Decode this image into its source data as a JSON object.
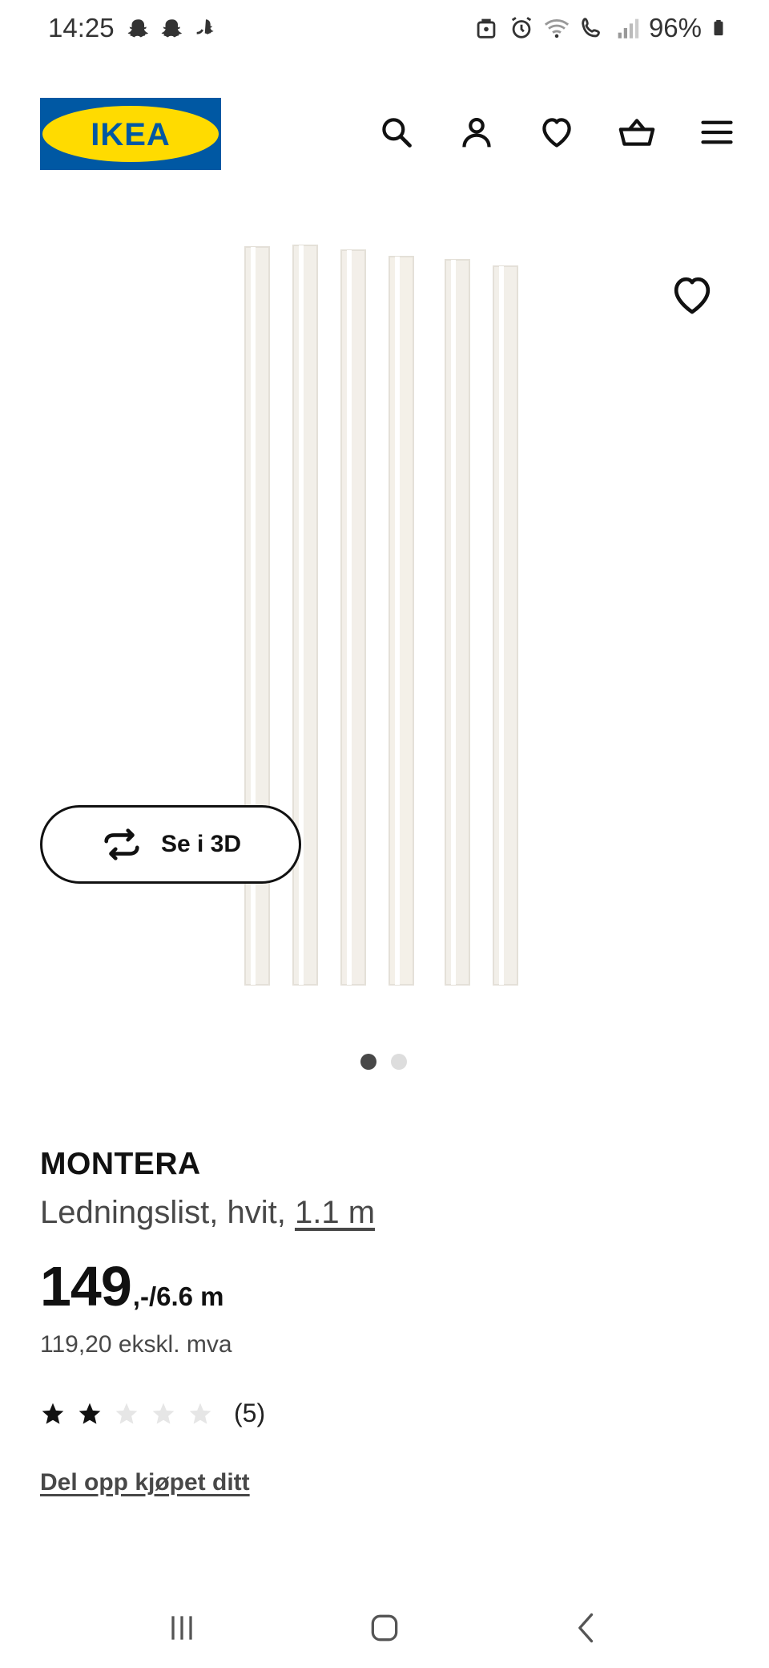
{
  "status": {
    "time": "14:25",
    "battery": "96%",
    "left_icons": [
      "snapchat-icon",
      "snapchat-icon",
      "snapchat-icon"
    ],
    "right_icons": [
      "briefcase-icon",
      "alarm-icon",
      "wifi-icon",
      "wifi-call-icon",
      "signal-icon",
      "battery-icon"
    ]
  },
  "header": {
    "logo_text": "IKEA",
    "icons": [
      "search-icon",
      "account-icon",
      "heart-icon",
      "cart-icon",
      "menu-icon"
    ]
  },
  "gallery": {
    "button_3d_label": "Se i 3D",
    "dots": 2,
    "active_dot": 0
  },
  "product": {
    "name": "MONTERA",
    "description": "Ledningslist, hvit,",
    "size": "1.1 m",
    "price_main": "149",
    "price_suffix": ",-/6.6 m",
    "price_excl": "119,20 ekskl. mva",
    "rating": 2,
    "rating_max": 5,
    "rating_count": "(5)",
    "split_link": "Del opp kjøpet ditt"
  },
  "colors": {
    "ikea_blue": "#0058A3",
    "ikea_yellow": "#FFDB00",
    "text_primary": "#111111",
    "text_secondary": "#484848"
  }
}
